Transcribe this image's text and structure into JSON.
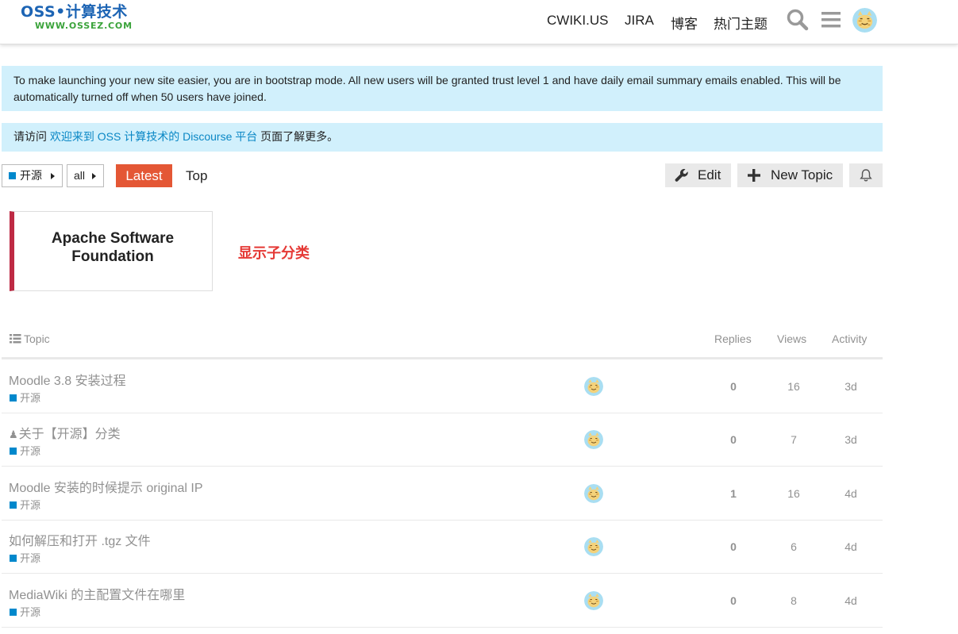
{
  "header": {
    "logo_top": "OSS•计算技术",
    "logo_bottom": "WWW.OSSEZ.COM",
    "nav": [
      "CWIKI.US",
      "JIRA",
      "博客",
      "热门主题"
    ],
    "icons": [
      "search-icon",
      "hamburger-menu-icon",
      "user-avatar"
    ]
  },
  "alerts": {
    "bootstrap": "To make launching your new site easier, you are in bootstrap mode. All new users will be granted trust level 1 and have daily email summary emails enabled. This will be automatically turned off when 50 users have joined.",
    "welcome_prefix": "请访问 ",
    "welcome_link": "欢迎来到 OSS 计算技术的 Discourse 平台",
    "welcome_suffix": " 页面了解更多。"
  },
  "controls": {
    "category_drop": "开源",
    "sub_drop": "all",
    "tab_latest": "Latest",
    "tab_top": "Top",
    "edit": "Edit",
    "new_topic": "New Topic",
    "notifications_icon": "bell-icon"
  },
  "subcategory": {
    "name": "Apache Software Foundation",
    "note": "显示子分类",
    "color": "#be2a44"
  },
  "table": {
    "headers": {
      "topic": "Topic",
      "replies": "Replies",
      "views": "Views",
      "activity": "Activity"
    },
    "rows": [
      {
        "title": "Moodle 3.8 安装过程",
        "pinned": false,
        "category": "开源",
        "replies": "0",
        "views": "16",
        "activity": "3d"
      },
      {
        "title": "关于【开源】分类",
        "pinned": true,
        "category": "开源",
        "replies": "0",
        "views": "7",
        "activity": "3d"
      },
      {
        "title": "Moodle 安装的时候提示 original IP",
        "pinned": false,
        "category": "开源",
        "replies": "1",
        "views": "16",
        "activity": "4d"
      },
      {
        "title": "如何解压和打开 .tgz 文件",
        "pinned": false,
        "category": "开源",
        "replies": "0",
        "views": "6",
        "activity": "4d"
      },
      {
        "title": "MediaWiki 的主配置文件在哪里",
        "pinned": false,
        "category": "开源",
        "replies": "0",
        "views": "8",
        "activity": "4d"
      }
    ]
  },
  "colors": {
    "accent": "#e45735",
    "alert_bg": "#d1f0fc",
    "link": "#0a87c5",
    "category": "#0088cc"
  }
}
